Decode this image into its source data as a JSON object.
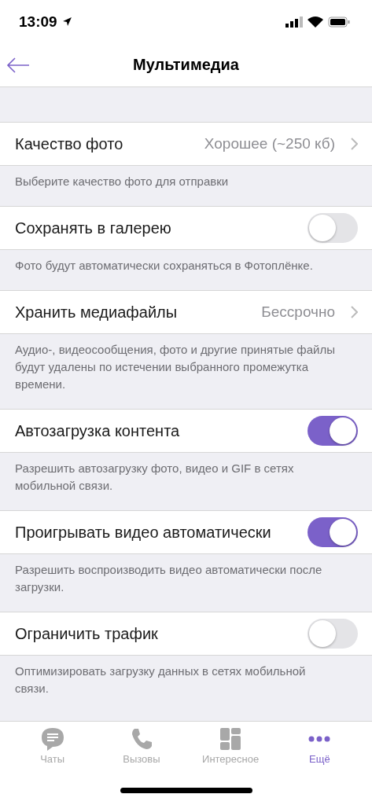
{
  "status_bar": {
    "time": "13:09"
  },
  "nav": {
    "title": "Мультимедиа"
  },
  "settings": [
    {
      "kind": "value",
      "label": "Качество фото",
      "value": "Хорошее (~250 кб)",
      "description": "Выберите качество фото для отправки"
    },
    {
      "kind": "toggle",
      "label": "Сохранять в галерею",
      "on": false,
      "description": "Фото будут автоматически сохраняться в Фотоплёнке."
    },
    {
      "kind": "value",
      "label": "Хранить медиафайлы",
      "value": "Бессрочно",
      "description": "Аудио-, видеосообщения, фото и другие принятые файлы будут удалены по истечении выбранного промежутка времени."
    },
    {
      "kind": "toggle",
      "label": "Автозагрузка контента",
      "on": true,
      "description": "Разрешить автозагрузку фото, видео и GIF в сетях мобильной связи."
    },
    {
      "kind": "toggle",
      "label": "Проигрывать видео автоматически",
      "on": true,
      "description": "Разрешить воспроизводить видео автоматически после загрузки."
    },
    {
      "kind": "toggle",
      "label": "Ограничить трафик",
      "on": false,
      "description": "Оптимизировать загрузку данных в сетях мобильной связи."
    }
  ],
  "tabs": [
    {
      "kind": "chats",
      "label": "Чаты",
      "selected": false
    },
    {
      "kind": "calls",
      "label": "Вызовы",
      "selected": false
    },
    {
      "kind": "explore",
      "label": "Интересное",
      "selected": false
    },
    {
      "kind": "more",
      "label": "Ещё",
      "selected": true
    }
  ]
}
